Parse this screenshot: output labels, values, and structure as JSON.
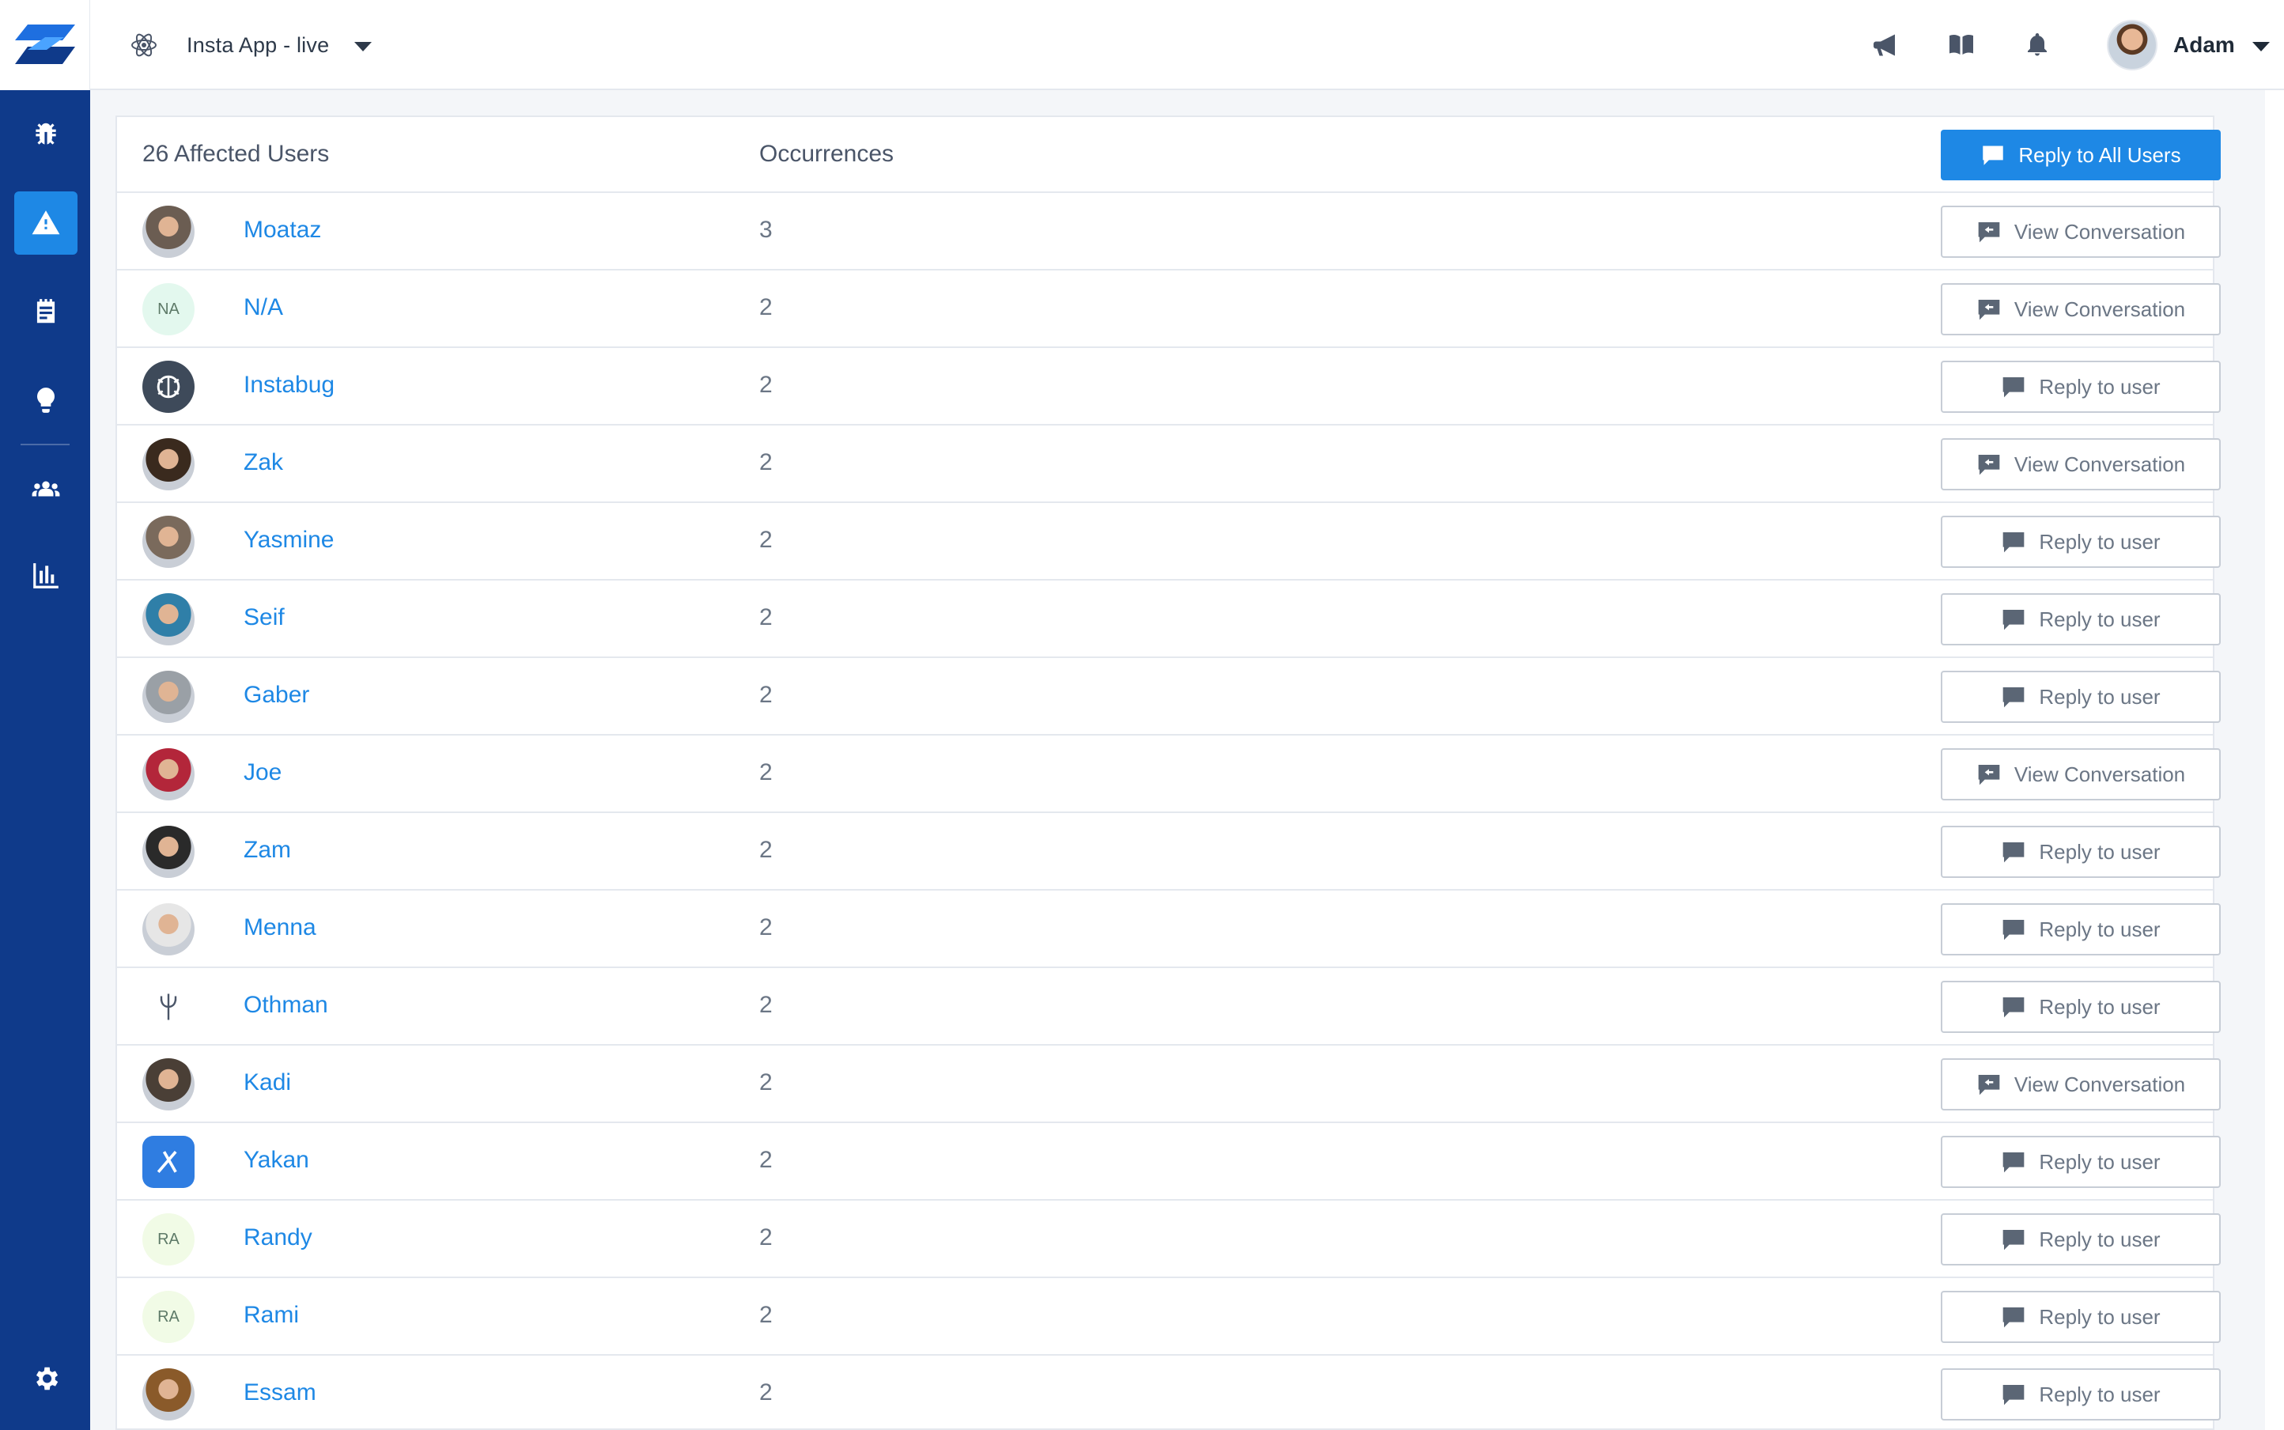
{
  "topbar": {
    "app_name": "Insta App - live",
    "user_name": "Adam"
  },
  "table": {
    "title": "26 Affected Users",
    "occurrences_header": "Occurrences",
    "reply_all_label": "Reply to All Users",
    "rows": [
      {
        "name": "Moataz",
        "occurrences": "3",
        "action": "View Conversation",
        "avatar": "photo",
        "color": "#6b5d52"
      },
      {
        "name": "N/A",
        "occurrences": "2",
        "action": "View Conversation",
        "avatar": "initials",
        "initials": "NA",
        "color": "#e3f8ee"
      },
      {
        "name": "Instabug",
        "occurrences": "2",
        "action": "Reply to user",
        "avatar": "logo",
        "color": "#3e4a5a"
      },
      {
        "name": "Zak",
        "occurrences": "2",
        "action": "View Conversation",
        "avatar": "photo",
        "color": "#3a2a1e"
      },
      {
        "name": "Yasmine",
        "occurrences": "2",
        "action": "Reply to user",
        "avatar": "photo",
        "color": "#7a6a5c"
      },
      {
        "name": "Seif",
        "occurrences": "2",
        "action": "Reply to user",
        "avatar": "photo",
        "color": "#2f7fa8"
      },
      {
        "name": "Gaber",
        "occurrences": "2",
        "action": "Reply to user",
        "avatar": "photo",
        "color": "#9aa0a6"
      },
      {
        "name": "Joe",
        "occurrences": "2",
        "action": "View Conversation",
        "avatar": "photo",
        "color": "#b3263a"
      },
      {
        "name": "Zam",
        "occurrences": "2",
        "action": "Reply to user",
        "avatar": "photo",
        "color": "#2a2a2a"
      },
      {
        "name": "Menna",
        "occurrences": "2",
        "action": "Reply to user",
        "avatar": "photo",
        "color": "#e6e6e6"
      },
      {
        "name": "Othman",
        "occurrences": "2",
        "action": "Reply to user",
        "avatar": "trident",
        "color": "#ffffff"
      },
      {
        "name": "Kadi",
        "occurrences": "2",
        "action": "View Conversation",
        "avatar": "photo",
        "color": "#4a3f36"
      },
      {
        "name": "Yakan",
        "occurrences": "2",
        "action": "Reply to user",
        "avatar": "xcode",
        "color": "#2f7de1"
      },
      {
        "name": "Randy",
        "occurrences": "2",
        "action": "Reply to user",
        "avatar": "initials",
        "initials": "RA",
        "color": "#f1fbe6"
      },
      {
        "name": "Rami",
        "occurrences": "2",
        "action": "Reply to user",
        "avatar": "initials",
        "initials": "RA",
        "color": "#f1fbe6"
      },
      {
        "name": "Essam",
        "occurrences": "2",
        "action": "Reply to user",
        "avatar": "photo",
        "color": "#8a5a2a"
      }
    ]
  },
  "colors": {
    "sidebar": "#0f3a8a",
    "accent": "#1e88e5",
    "link": "#1e88e5",
    "border": "#e4e8ee"
  },
  "icons": {
    "sidebar": [
      "bug-icon",
      "alert-icon",
      "notes-icon",
      "lightbulb-icon",
      "users-icon",
      "chart-icon",
      "gear-icon"
    ],
    "topbar": [
      "react-icon",
      "megaphone-icon",
      "book-icon",
      "bell-icon"
    ]
  }
}
